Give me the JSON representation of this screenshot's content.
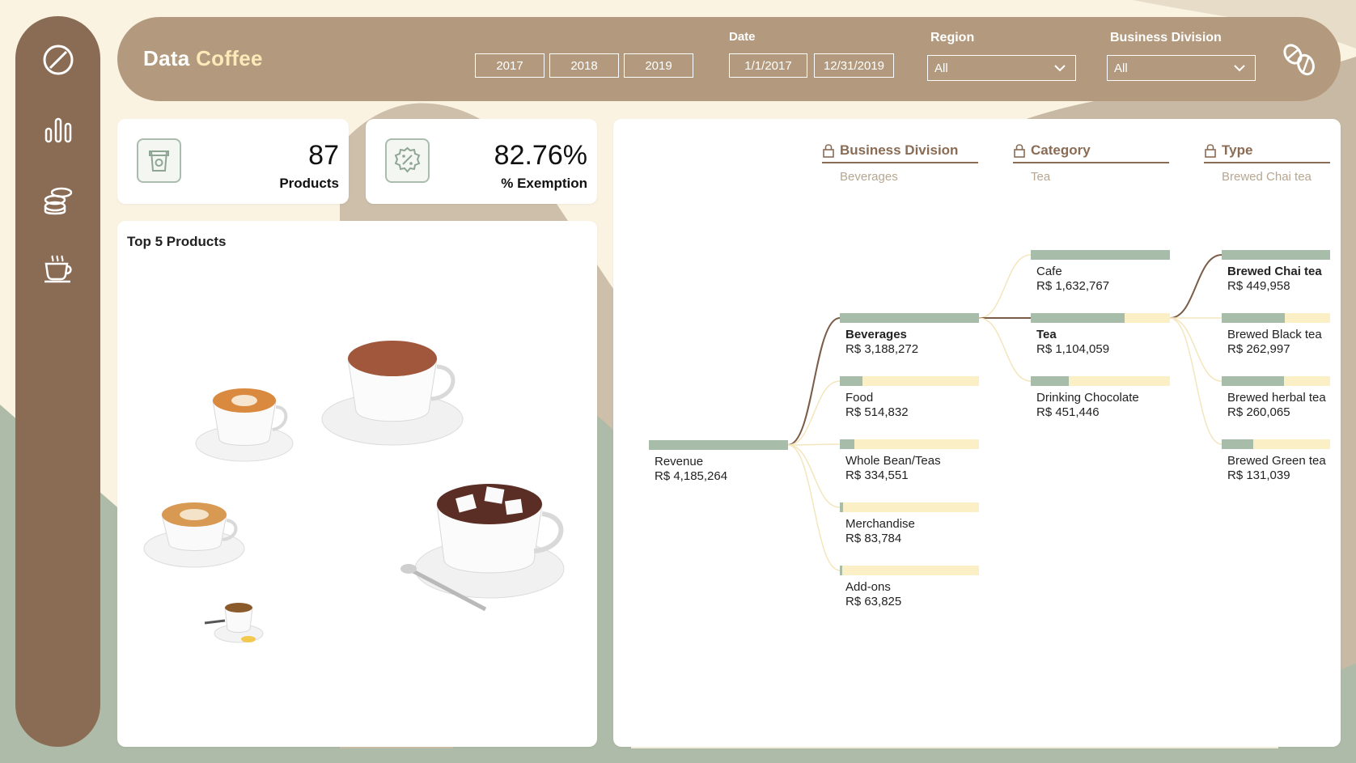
{
  "header": {
    "brand_part1": "Data",
    "brand_part2": "Coffee",
    "years": [
      "2017",
      "2018",
      "2019"
    ],
    "date_label": "Date",
    "date_start": "1/1/2017",
    "date_end": "12/31/2019",
    "region_label": "Region",
    "region_value": "All",
    "division_label": "Business Division",
    "division_value": "All"
  },
  "sidebar": {
    "items": [
      "coffee-bean-icon",
      "bar-chart-icon",
      "coins-icon",
      "coffee-cup-icon"
    ]
  },
  "kpis": [
    {
      "value": "87",
      "label": "Products",
      "icon": "cup-icon"
    },
    {
      "value": "82.76%",
      "label": "% Exemption",
      "icon": "percent-badge-icon"
    }
  ],
  "top_products": {
    "title": "Top 5 Products"
  },
  "tree": {
    "levels": [
      {
        "title": "Business Division",
        "selected": "Beverages"
      },
      {
        "title": "Category",
        "selected": "Tea"
      },
      {
        "title": "Type",
        "selected": "Brewed Chai tea"
      }
    ],
    "root": {
      "label": "Revenue",
      "value": "R$ 4,185,264",
      "share": 1.0
    },
    "division": [
      {
        "label": "Beverages",
        "value": "R$ 3,188,272",
        "share": 1.0,
        "bold": true
      },
      {
        "label": "Food",
        "value": "R$ 514,832",
        "share": 0.161
      },
      {
        "label": "Whole Bean/Teas",
        "value": "R$ 334,551",
        "share": 0.105
      },
      {
        "label": "Merchandise",
        "value": "R$ 83,784",
        "share": 0.026
      },
      {
        "label": "Add-ons",
        "value": "R$ 63,825",
        "share": 0.02
      }
    ],
    "category": [
      {
        "label": "Cafe",
        "value": "R$ 1,632,767",
        "share": 1.0
      },
      {
        "label": "Tea",
        "value": "R$ 1,104,059",
        "share": 0.676,
        "bold": true
      },
      {
        "label": "Drinking Chocolate",
        "value": "R$ 451,446",
        "share": 0.276
      }
    ],
    "type": [
      {
        "label": "Brewed Chai tea",
        "value": "R$ 449,958",
        "share": 1.0,
        "bold": true
      },
      {
        "label": "Brewed Black tea",
        "value": "R$ 262,997",
        "share": 0.584
      },
      {
        "label": "Brewed herbal tea",
        "value": "R$ 260,065",
        "share": 0.578
      },
      {
        "label": "Brewed Green tea",
        "value": "R$ 131,039",
        "share": 0.291
      }
    ]
  },
  "colors": {
    "sidebar": "#8a6c55",
    "header": "#b39a7e",
    "bar_fill": "#a7bca9",
    "bar_track": "#fbefc5",
    "background": "#fbf3e2"
  }
}
